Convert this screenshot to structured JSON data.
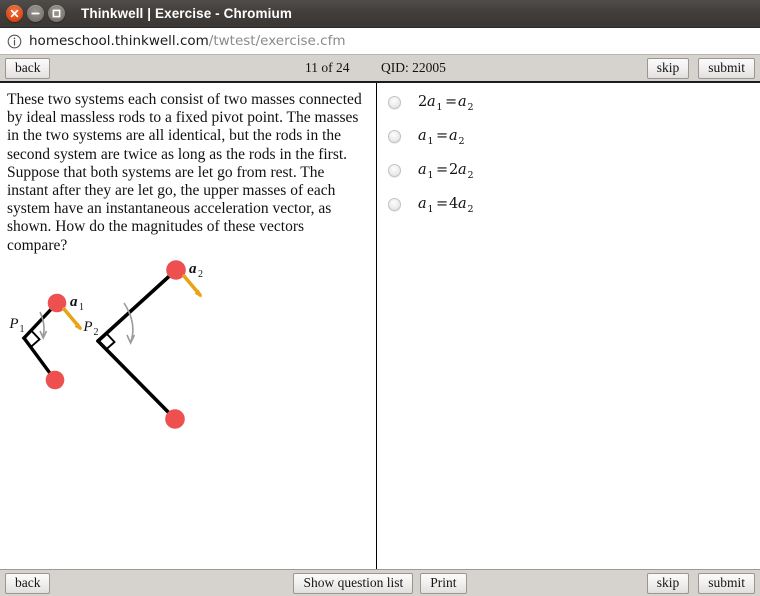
{
  "window": {
    "title": "Thinkwell | Exercise - Chromium",
    "controls": [
      {
        "name": "close",
        "glyph": "×"
      },
      {
        "name": "minimize",
        "glyph": "−"
      },
      {
        "name": "maximize",
        "glyph": "□"
      }
    ]
  },
  "urlbar": {
    "icon": "info-circle-icon",
    "url_strong": "homeschool.thinkwell.com",
    "url_dim": "/twtest/exercise.cfm"
  },
  "toolbar_top": {
    "back_label": "back",
    "counter": "11 of 24",
    "qid": "QID: 22005",
    "skip_label": "skip",
    "submit_label": "submit"
  },
  "toolbar_bottom": {
    "back_label": "back",
    "show_question_list_label": "Show question list",
    "print_label": "Print",
    "skip_label": "skip",
    "submit_label": "submit"
  },
  "question": {
    "text": "These two systems each consist of two masses connected by ideal massless rods to a fixed pivot point. The masses in the two systems are all identical, but the rods in the second system are twice as long as the rods in the first. Suppose that both systems are let go from rest. The instant after they are let go, the upper masses of each system have an instantaneous acceleration vector, as shown. How do the magnitudes of these vectors compare?"
  },
  "figure": {
    "pivot1_label_base": "P",
    "pivot1_label_sub": "1",
    "pivot2_label_base": "P",
    "pivot2_label_sub": "2",
    "accel1_label_base": "a",
    "accel1_label_sub": "1",
    "accel2_label_base": "a",
    "accel2_label_sub": "2",
    "mass_color": "#ee5050",
    "rod_color": "#000000",
    "vector_color": "#e8a317",
    "arc_color": "#9a9a9a"
  },
  "options": [
    {
      "id": "opt-a",
      "lhs_coef": "2",
      "lhs_base": "a",
      "lhs_sub": "1",
      "rel": "=",
      "rhs_coef": "",
      "rhs_base": "a",
      "rhs_sub": "2",
      "text": "2a1 = a2",
      "selected": false
    },
    {
      "id": "opt-b",
      "lhs_coef": "",
      "lhs_base": "a",
      "lhs_sub": "1",
      "rel": "=",
      "rhs_coef": "",
      "rhs_base": "a",
      "rhs_sub": "2",
      "text": "a1 = a2",
      "selected": false
    },
    {
      "id": "opt-c",
      "lhs_coef": "",
      "lhs_base": "a",
      "lhs_sub": "1",
      "rel": "=",
      "rhs_coef": "2",
      "rhs_base": "a",
      "rhs_sub": "2",
      "text": "a1 = 2a2",
      "selected": false
    },
    {
      "id": "opt-d",
      "lhs_coef": "",
      "lhs_base": "a",
      "lhs_sub": "1",
      "rel": "=",
      "rhs_coef": "4",
      "rhs_base": "a",
      "rhs_sub": "2",
      "text": "a1 = 4a2",
      "selected": false
    }
  ]
}
